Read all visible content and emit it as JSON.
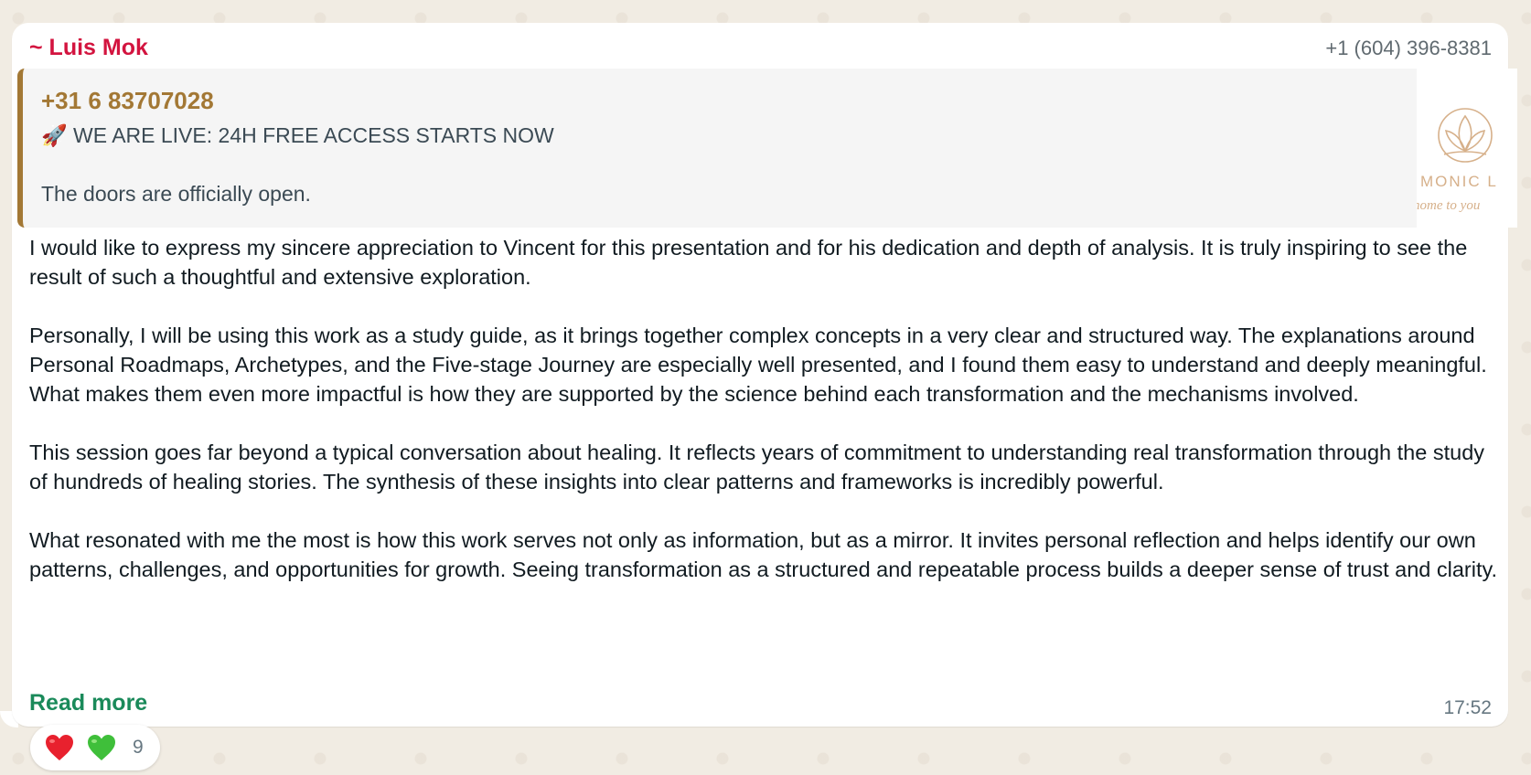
{
  "message": {
    "sender_name": "~ Luis Mok",
    "sender_phone": "+1 (604) 396-8381",
    "quoted": {
      "author": "+31 6 83707028",
      "line1": "🚀 WE ARE LIVE: 24H FREE ACCESS STARTS NOW",
      "line2": "The doors are officially open.",
      "thumb_text1": "MONIC L",
      "thumb_text2": "home to you"
    },
    "paragraphs": [
      "I would like to express my sincere appreciation to Vincent for this presentation and for his dedication and depth of analysis. It is truly inspiring to see the result of such a thoughtful and extensive exploration.",
      "Personally, I will be using this work as a study guide, as it brings together complex concepts in a very clear and structured way. The explanations around Personal Roadmaps, Archetypes, and the Five-stage Journey are especially well presented, and I found them easy to understand and deeply meaningful. What makes them even more impactful is how they are supported by the science behind each transformation and the mechanisms involved.",
      "This session goes far beyond a typical conversation about healing. It reflects years of commitment to understanding real transformation through the study of hundreds of healing stories. The synthesis of these insights into clear patterns and frameworks is incredibly powerful.",
      "What resonated with me the most is how this work serves not only as information, but as a mirror. It invites personal reflection and helps identify our own patterns, challenges, and opportunities for growth. Seeing transformation as a structured and repeatable process builds a deeper sense of trust and clarity."
    ],
    "read_more": "Read more",
    "time": "17:52",
    "reactions": {
      "emojis": [
        "red-heart",
        "green-heart"
      ],
      "count": "9"
    }
  },
  "colors": {
    "sender": "#d3143f",
    "quote_accent": "#a37835",
    "read_more": "#1a8a5a",
    "bubble": "#ffffff"
  }
}
